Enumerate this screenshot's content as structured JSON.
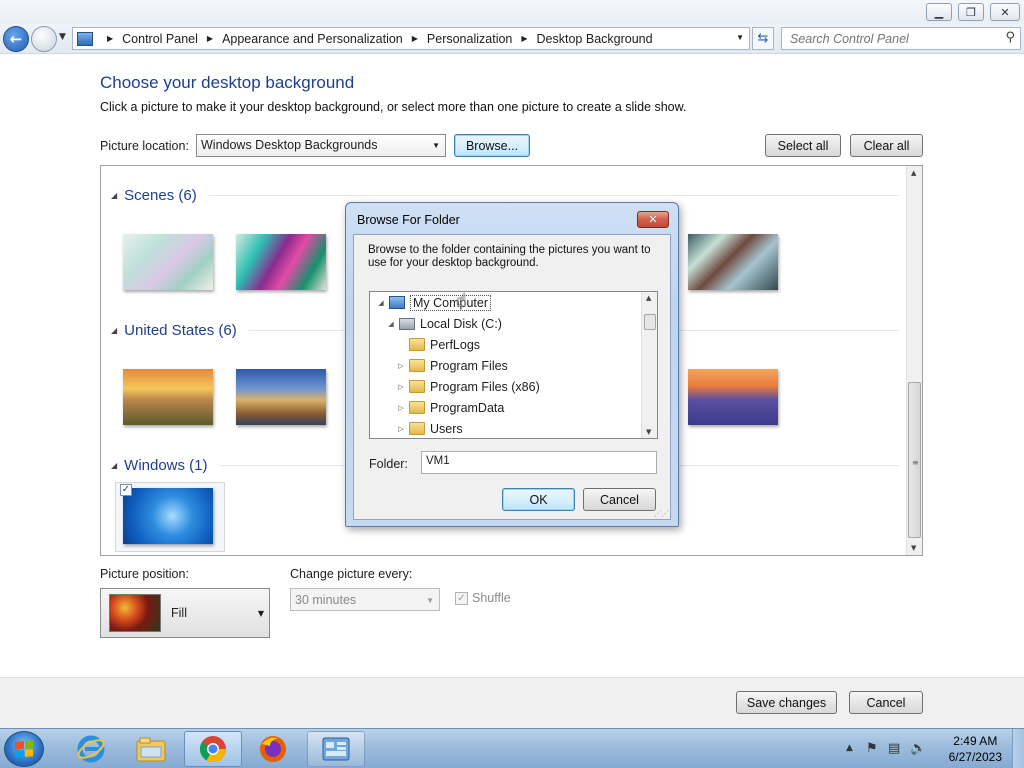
{
  "addressbar": {
    "breadcrumbs": [
      "Control Panel",
      "Appearance and Personalization",
      "Personalization",
      "Desktop Background"
    ],
    "search_placeholder": "Search Control Panel"
  },
  "content": {
    "heading": "Choose your desktop background",
    "subtext": "Click a picture to make it your desktop background, or select more than one picture to create a slide show.",
    "picture_location_label": "Picture location:",
    "picture_location_value": "Windows Desktop Backgrounds",
    "browse_label": "Browse...",
    "select_all_label": "Select all",
    "clear_all_label": "Clear all"
  },
  "gallery": {
    "groups": [
      {
        "title": "Scenes (6)"
      },
      {
        "title": "United States (6)"
      },
      {
        "title": "Windows (1)"
      }
    ],
    "windows_selected": true
  },
  "options": {
    "position_label": "Picture position:",
    "position_value": "Fill",
    "change_label": "Change picture every:",
    "change_value": "30 minutes",
    "shuffle_label": "Shuffle",
    "shuffle_checked": true
  },
  "footer": {
    "save_label": "Save changes",
    "cancel_label": "Cancel"
  },
  "dialog": {
    "title": "Browse For Folder",
    "description": "Browse to the folder containing the pictures you want to use for your desktop background.",
    "tree": [
      {
        "label": "My Computer",
        "expanded": true,
        "icon": "computer-icon"
      },
      {
        "label": "Local Disk (C:)",
        "expanded": true,
        "icon": "drive-icon"
      },
      {
        "label": "PerfLogs",
        "expandable": false,
        "icon": "folder-icon"
      },
      {
        "label": "Program Files",
        "expandable": true,
        "icon": "folder-icon"
      },
      {
        "label": "Program Files (x86)",
        "expandable": true,
        "icon": "folder-icon"
      },
      {
        "label": "ProgramData",
        "expandable": true,
        "icon": "folder-icon"
      },
      {
        "label": "Users",
        "expandable": true,
        "icon": "folder-icon"
      }
    ],
    "folder_label": "Folder:",
    "folder_value": "VM1",
    "ok_label": "OK",
    "cancel_label": "Cancel"
  },
  "taskbar": {
    "items": [
      "internet-explorer-icon",
      "file-explorer-icon",
      "chrome-icon",
      "firefox-icon",
      "control-panel-icon"
    ],
    "time": "2:49 AM",
    "date": "6/27/2023"
  },
  "colors": {
    "heading_blue": "#1e3f8f",
    "taskbar": "#9cbcdc",
    "dialog_frame": "#c7d9f0",
    "close_red": "#c14a34"
  }
}
